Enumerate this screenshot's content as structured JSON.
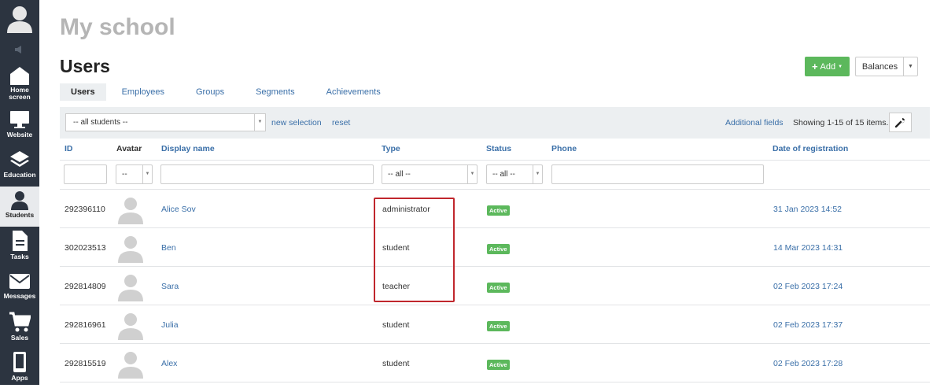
{
  "sidebar": {
    "items": [
      {
        "label": "Home screen",
        "icon": "home-icon"
      },
      {
        "label": "Website",
        "icon": "monitor-icon"
      },
      {
        "label": "Education",
        "icon": "layers-icon"
      },
      {
        "label": "Students",
        "icon": "user-icon",
        "active": true
      },
      {
        "label": "Tasks",
        "icon": "document-icon"
      },
      {
        "label": "Messages",
        "icon": "envelope-icon"
      },
      {
        "label": "Sales",
        "icon": "cart-icon"
      },
      {
        "label": "Apps",
        "icon": "phone-icon"
      }
    ]
  },
  "header": {
    "app_title": "My school",
    "page_title": "Users"
  },
  "toolbar": {
    "add_label": "Add",
    "balances_label": "Balances"
  },
  "tabs": [
    "Users",
    "Employees",
    "Groups",
    "Segments",
    "Achievements"
  ],
  "filter": {
    "selection_value": "-- all students --",
    "new_selection": "new selection",
    "reset": "reset",
    "additional_fields": "Additional fields",
    "showing": "Showing 1-15 of 15 items."
  },
  "columns": {
    "id": "ID",
    "avatar": "Avatar",
    "display_name": "Display name",
    "type": "Type",
    "status": "Status",
    "phone": "Phone",
    "date": "Date of registration"
  },
  "column_filters": {
    "avatar": "--",
    "type": "-- all --",
    "status": "-- all --"
  },
  "rows": [
    {
      "id": "292396110",
      "name": "Alice Sov",
      "type": "administrator",
      "status": "Active",
      "date": "31 Jan 2023 14:52"
    },
    {
      "id": "302023513",
      "name": "Ben",
      "type": "student",
      "status": "Active",
      "date": "14 Mar 2023 14:31"
    },
    {
      "id": "292814809",
      "name": "Sara",
      "type": "teacher",
      "status": "Active",
      "date": "02 Feb 2023 17:24"
    },
    {
      "id": "292816961",
      "name": "Julia",
      "type": "student",
      "status": "Active",
      "date": "02 Feb 2023 17:37"
    },
    {
      "id": "292815519",
      "name": "Alex",
      "type": "student",
      "status": "Active",
      "date": "02 Feb 2023 17:28"
    }
  ],
  "colors": {
    "sidebar": "#2c3440",
    "accent_green": "#5cb85c",
    "link": "#3a6fa8",
    "highlight": "#c0272d"
  }
}
